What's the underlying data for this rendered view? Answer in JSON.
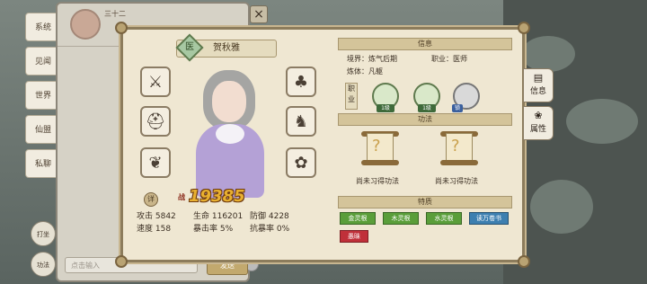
{
  "left_tabs": [
    "系统",
    "见闻",
    "世界",
    "仙盟",
    "私聊"
  ],
  "left_side_buttons": [
    "打坐",
    "功法"
  ],
  "chat": {
    "name": "三十二",
    "input_placeholder": "点击输入",
    "send_label": "发送"
  },
  "character": {
    "profession_badge": "医",
    "name": "贺秋雅",
    "power_badge": "详",
    "power_label": "战",
    "power": "19385"
  },
  "stats": {
    "attack": "攻击 5842",
    "hp": "生命 116201",
    "defense": "防御 4228",
    "speed": "速度 158",
    "crit": "暴击率 5%",
    "anti_crit": "抗暴率 0%"
  },
  "info": {
    "header": "信息",
    "realm": "境界：炼气后期",
    "profession": "职业：医师",
    "body": "炼体：凡躯",
    "profession_vertical": "职业",
    "skills": [
      {
        "level": "1级",
        "color": "green"
      },
      {
        "level": "1级",
        "color": "green"
      },
      {
        "level": "锁",
        "color": "grey"
      }
    ]
  },
  "gongfa": {
    "header": "功法",
    "slot1": "尚未习得功法",
    "slot2": "尚未习得功法"
  },
  "traits": {
    "header": "特质",
    "items": [
      {
        "label": "金灵根",
        "color": "#5a9e3a"
      },
      {
        "label": "木灵根",
        "color": "#5a9e3a"
      },
      {
        "label": "水灵根",
        "color": "#5a9e3a"
      },
      {
        "label": "读万卷书",
        "color": "#3d7fb0"
      },
      {
        "label": "愚昧",
        "color": "#c0303a"
      }
    ]
  },
  "right_tabs": [
    "信息",
    "属性"
  ],
  "close_label": "×"
}
